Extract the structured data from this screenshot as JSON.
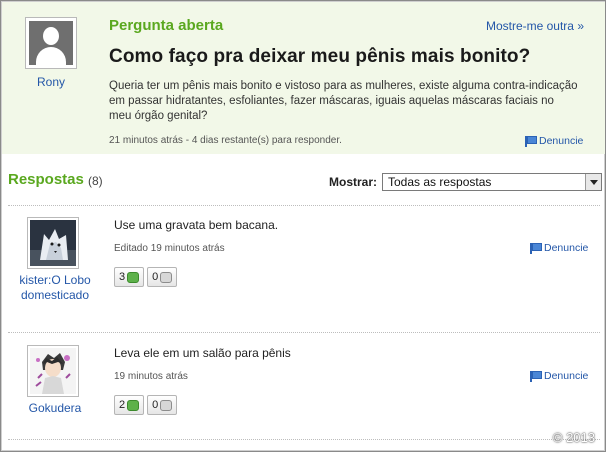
{
  "question": {
    "status": "Pergunta aberta",
    "other_link": "Mostre-me outra »",
    "user": "Rony",
    "title": "Como faço pra deixar meu pênis mais bonito?",
    "body": "Queria ter um pênis mais bonito e vistoso para as mulheres, existe alguma contra-indicação em passar hidratantes, esfoliantes, fazer máscaras, iguais aquelas máscaras faciais no meu órgão genital?",
    "meta": "21 minutos atrás - 4 dias restante(s) para responder.",
    "report_label": "Denuncie"
  },
  "answers_header": {
    "title": "Respostas",
    "count": "(8)",
    "show_label": "Mostrar:",
    "filter_value": "Todas as respostas"
  },
  "answers": [
    {
      "user": "kister:O Lobo domesticado",
      "text": "Use uma gravata bem bacana.",
      "meta": "Editado 19 minutos atrás",
      "up_votes": "3",
      "down_votes": "0",
      "report_label": "Denuncie"
    },
    {
      "user": "Gokudera",
      "text": "Leva ele em um salão para pênis",
      "meta": "19 minutos atrás",
      "up_votes": "2",
      "down_votes": "0",
      "report_label": "Denuncie"
    }
  ],
  "watermark": "© 2013",
  "colors": {
    "accent_green": "#5aa81f",
    "link_blue": "#2457a8",
    "question_bg": "#f2f8e8"
  },
  "icons": {
    "default_avatar": "user-silhouette-icon",
    "report": "flag-icon",
    "thumb_up": "thumb-up-icon",
    "thumb_down": "thumb-down-icon",
    "dropdown": "chevron-down-icon"
  }
}
